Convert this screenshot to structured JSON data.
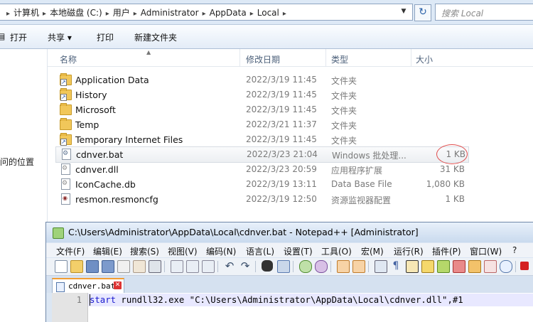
{
  "address": {
    "crumbs": [
      "计算机",
      "本地磁盘 (C:)",
      "用户",
      "Administrator",
      "AppData",
      "Local"
    ],
    "search_placeholder": "搜索 Local"
  },
  "command_bar": {
    "open": "打开",
    "share": "共享 ▾",
    "print": "打印",
    "new_folder": "新建文件夹"
  },
  "nav": {
    "partial_label": "问的位置"
  },
  "columns": {
    "name": "名称",
    "modified": "修改日期",
    "type": "类型",
    "size": "大小"
  },
  "files": [
    {
      "name": "Application Data",
      "date": "2022/3/19 11:45",
      "type": "文件夹",
      "size": "",
      "icon": "folder-shortcut-icon"
    },
    {
      "name": "History",
      "date": "2022/3/19 11:45",
      "type": "文件夹",
      "size": "",
      "icon": "folder-shortcut-icon"
    },
    {
      "name": "Microsoft",
      "date": "2022/3/19 11:45",
      "type": "文件夹",
      "size": "",
      "icon": "folder-icon"
    },
    {
      "name": "Temp",
      "date": "2022/3/21 11:37",
      "type": "文件夹",
      "size": "",
      "icon": "folder-icon"
    },
    {
      "name": "Temporary Internet Files",
      "date": "2022/3/19 11:45",
      "type": "文件夹",
      "size": "",
      "icon": "folder-shortcut-icon"
    },
    {
      "name": "cdnver.bat",
      "date": "2022/3/23 21:04",
      "type": "Windows 批处理...",
      "size": "1 KB",
      "icon": "batch-file-icon",
      "selected": true
    },
    {
      "name": "cdnver.dll",
      "date": "2022/3/23 20:59",
      "type": "应用程序扩展",
      "size": "31 KB",
      "icon": "dll-file-icon"
    },
    {
      "name": "IconCache.db",
      "date": "2022/3/19 13:11",
      "type": "Data Base File",
      "size": "1,080 KB",
      "icon": "db-file-icon"
    },
    {
      "name": "resmon.resmoncfg",
      "date": "2022/3/19 12:50",
      "type": "资源监视器配置",
      "size": "1 KB",
      "icon": "resmon-file-icon"
    }
  ],
  "notepad": {
    "title": "C:\\Users\\Administrator\\AppData\\Local\\cdnver.bat - Notepad++ [Administrator]",
    "menu": [
      "文件(F)",
      "编辑(E)",
      "搜索(S)",
      "视图(V)",
      "编码(N)",
      "语言(L)",
      "设置(T)",
      "工具(O)",
      "宏(M)",
      "运行(R)",
      "插件(P)",
      "窗口(W)",
      "?"
    ],
    "tab": "cdnver.bat",
    "line_number": "1",
    "code_keyword": "start",
    "code_rest": " rundll32.exe \"C:\\Users\\Administrator\\AppData\\Local\\cdnver.dll\",#1"
  }
}
